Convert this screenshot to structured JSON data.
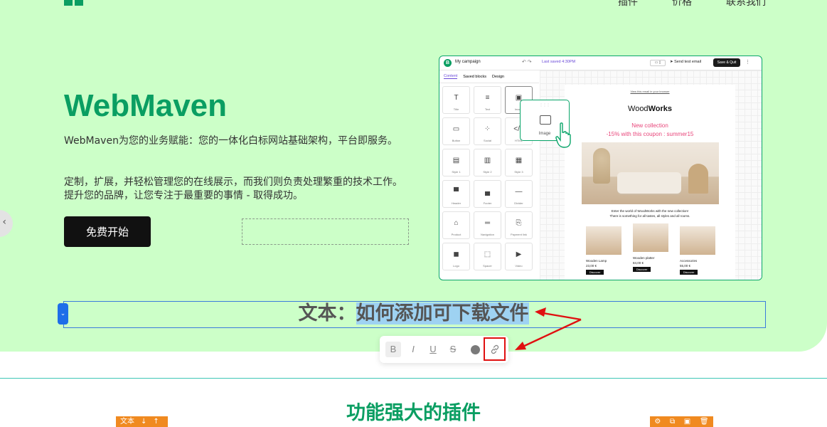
{
  "nav": {
    "items": [
      "插件",
      "价格",
      "联系我们"
    ]
  },
  "hero": {
    "brand": "WebMaven",
    "description_1": "WebMaven为您的业务赋能：您的一体化白标网站基础架构，平台即服务。",
    "description_2": "定制，扩展，并轻松管理您的在线展示，而我们则负责处理繁重的技术工作。提升您的品牌，让您专注于最重要的事情 - 取得成功。",
    "cta_label": "免费开始",
    "side_tab_icon": "chevron-left-icon"
  },
  "app": {
    "campaign": "My campaign",
    "saved": "Last saved 4:30PM",
    "send_test": "Send test email",
    "save_quit": "Save & Quit",
    "tabs": [
      "Content",
      "Saved blocks",
      "Design"
    ],
    "blocks": [
      "Title",
      "Text",
      "Image",
      "Button",
      "Social",
      "HTML",
      "Style 1",
      "Style 2",
      "Style 3",
      "Header",
      "Footer",
      "Divider",
      "Product",
      "Navigation",
      "Payment link",
      "Logo",
      "Spacer",
      "Video"
    ],
    "drag_label": "Image",
    "email": {
      "view_link": "View this email in your browser",
      "brand_prefix": "Wood",
      "brand_suffix": "Works",
      "new_collection": "New collection",
      "coupon": "-15% with this coupon : summer15",
      "enter_1": "Enter the world of WoodWorks with the new collection!",
      "enter_2": "There is something for all tastes, all styles and all rooms.",
      "products": [
        {
          "name": "Wooden Lamp",
          "price": "23,00 €",
          "button": "Discover"
        },
        {
          "name": "Wooden platter",
          "price": "84,00 €",
          "button": "Discover"
        },
        {
          "name": "Accessories",
          "price": "55,00 €",
          "button": "Discover"
        }
      ]
    }
  },
  "selection": {
    "prefix": "文本：",
    "highlight": "如何添加可下载文件"
  },
  "toolbar": {
    "bold": "B",
    "italic": "I",
    "underline": "U",
    "strike": "S",
    "highlight_color": "#e01010"
  },
  "section": {
    "title": "功能强大的插件",
    "badge_left": "文本",
    "accent": "#0a9e62"
  }
}
